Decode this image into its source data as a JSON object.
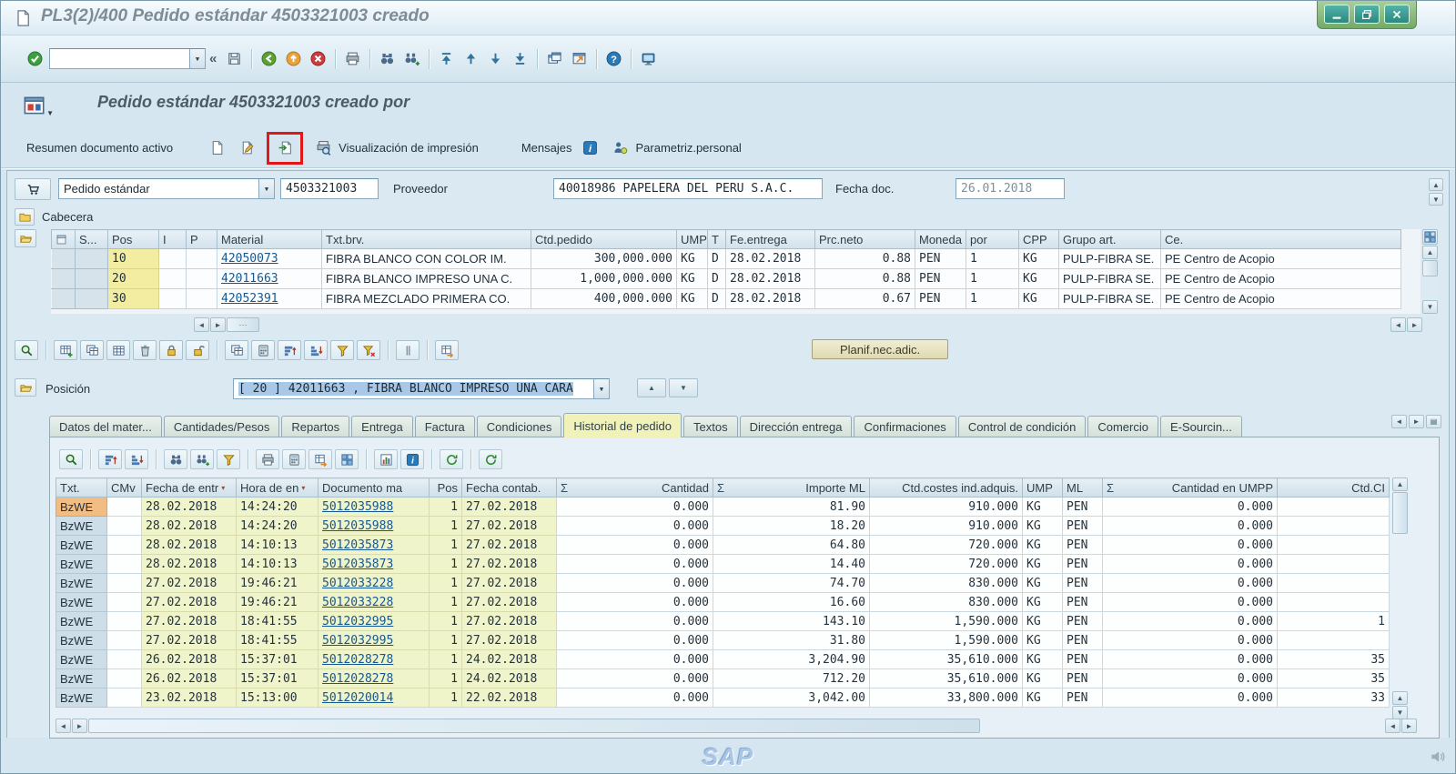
{
  "window": {
    "title": "PL3(2)/400 Pedido estándar 4503321003 creado"
  },
  "toolbar": {
    "command_value": "",
    "collapse_glyph": "«",
    "icons": [
      "save",
      "sep",
      "back",
      "exit",
      "cancel",
      "sep",
      "print",
      "sep",
      "find",
      "find-next",
      "sep",
      "first-page",
      "prev-page",
      "next-page",
      "last-page",
      "sep",
      "new-session",
      "create-shortcut",
      "sep",
      "help",
      "sep",
      "customize-layout"
    ]
  },
  "app_header": {
    "title": "Pedido estándar 4503321003 creado por"
  },
  "app_toolbar": {
    "overview_label": "Resumen documento activo",
    "icons_left": [
      "create-document",
      "display-change"
    ],
    "highlighted_icon": "other-purchase-document",
    "print_preview_label": "Visualización de impresión",
    "messages_label": "Mensajes",
    "personal_label": "Parametriz.personal"
  },
  "order_header": {
    "type_value": "Pedido estándar",
    "number_value": "4503321003",
    "vendor_label": "Proveedor",
    "vendor_value": "40018986 PAPELERA DEL PERU S.A.C.",
    "date_label": "Fecha doc.",
    "date_value": "26.01.2018"
  },
  "header_section_label": "Cabecera",
  "items": {
    "columns": [
      "",
      "S...",
      "Pos",
      "I",
      "P",
      "Material",
      "Txt.brv.",
      "Ctd.pedido",
      "UMP",
      "T",
      "Fe.entrega",
      "Prc.neto",
      "Moneda",
      "por",
      "CPP",
      "Grupo art.",
      "Ce."
    ],
    "rows": [
      {
        "pos": "10",
        "i": "",
        "p": "",
        "material": "42050073",
        "txt_brv": "FIBRA BLANCO CON COLOR IM.",
        "ctd_pedido": "300,000.000",
        "ump": "KG",
        "t": "D",
        "fe_entrega": "28.02.2018",
        "prc_neto": "0.88",
        "moneda": "PEN",
        "por": "1",
        "cpp": "KG",
        "grupo_art": "PULP-FIBRA SE.",
        "ce": "PE Centro de Acopio"
      },
      {
        "pos": "20",
        "i": "",
        "p": "",
        "material": "42011663",
        "txt_brv": "FIBRA BLANCO IMPRESO UNA C.",
        "ctd_pedido": "1,000,000.000",
        "ump": "KG",
        "t": "D",
        "fe_entrega": "28.02.2018",
        "prc_neto": "0.88",
        "moneda": "PEN",
        "por": "1",
        "cpp": "KG",
        "grupo_art": "PULP-FIBRA SE.",
        "ce": "PE Centro de Acopio"
      },
      {
        "pos": "30",
        "i": "",
        "p": "",
        "material": "42052391",
        "txt_brv": "FIBRA MEZCLADO PRIMERA CO.",
        "ctd_pedido": "400,000.000",
        "ump": "KG",
        "t": "D",
        "fe_entrega": "28.02.2018",
        "prc_neto": "0.67",
        "moneda": "PEN",
        "por": "1",
        "cpp": "KG",
        "grupo_art": "PULP-FIBRA SE.",
        "ce": "PE Centro de Acopio"
      }
    ],
    "toolbar_icons": [
      "magnifier",
      "sep",
      "table-insert",
      "table-copy",
      "table",
      "trash",
      "lock",
      "unlock",
      "sep",
      "duplicate",
      "calc",
      "sortasc",
      "sortdesc",
      "filter",
      "filter-del",
      "sep",
      "grip",
      "sep",
      "adopt"
    ],
    "planif_button_label": "Planif.nec.adic."
  },
  "position": {
    "label": "Posición",
    "value": "[ 20 ] 42011663 , FIBRA BLANCO IMPRESO UNA CARA"
  },
  "tabs": [
    "Datos del mater...",
    "Cantidades/Pesos",
    "Repartos",
    "Entrega",
    "Factura",
    "Condiciones",
    "Historial de pedido",
    "Textos",
    "Dirección entrega",
    "Confirmaciones",
    "Control de condición",
    "Comercio",
    "E-Sourcin..."
  ],
  "active_tab": "Historial de pedido",
  "history": {
    "sigma_symbol": "Σ",
    "toolbar_icons": [
      "details",
      "sep",
      "sortasc",
      "sortdesc",
      "sep",
      "find",
      "find-next",
      "filter",
      "sep",
      "print",
      "export-calc",
      "export-file",
      "views",
      "sep",
      "chart",
      "info",
      "sep",
      "refresh-menu",
      "sep",
      "refresh"
    ],
    "columns": [
      {
        "label": "Txt."
      },
      {
        "label": "CMv"
      },
      {
        "label": "Fecha de entr",
        "sort": true
      },
      {
        "label": "Hora de en",
        "sort": true
      },
      {
        "label": "Documento ma"
      },
      {
        "label": "Pos"
      },
      {
        "label": "Fecha contab."
      },
      {
        "label": "Cantidad",
        "sigma": true
      },
      {
        "label": "Importe ML",
        "sigma": true
      },
      {
        "label": "Ctd.costes ind.adquis."
      },
      {
        "label": "UMP"
      },
      {
        "label": "ML"
      },
      {
        "label": "Cantidad en UMPP",
        "sigma": true
      },
      {
        "label": "Ctd.CI"
      }
    ],
    "rows": [
      [
        "BzWE",
        "",
        "28.02.2018",
        "14:24:20",
        "5012035988",
        "1",
        "27.02.2018",
        "0.000",
        "81.90",
        "910.000",
        "KG",
        "PEN",
        "0.000",
        ""
      ],
      [
        "BzWE",
        "",
        "28.02.2018",
        "14:24:20",
        "5012035988",
        "1",
        "27.02.2018",
        "0.000",
        "18.20",
        "910.000",
        "KG",
        "PEN",
        "0.000",
        ""
      ],
      [
        "BzWE",
        "",
        "28.02.2018",
        "14:10:13",
        "5012035873",
        "1",
        "27.02.2018",
        "0.000",
        "64.80",
        "720.000",
        "KG",
        "PEN",
        "0.000",
        ""
      ],
      [
        "BzWE",
        "",
        "28.02.2018",
        "14:10:13",
        "5012035873",
        "1",
        "27.02.2018",
        "0.000",
        "14.40",
        "720.000",
        "KG",
        "PEN",
        "0.000",
        ""
      ],
      [
        "BzWE",
        "",
        "27.02.2018",
        "19:46:21",
        "5012033228",
        "1",
        "27.02.2018",
        "0.000",
        "74.70",
        "830.000",
        "KG",
        "PEN",
        "0.000",
        ""
      ],
      [
        "BzWE",
        "",
        "27.02.2018",
        "19:46:21",
        "5012033228",
        "1",
        "27.02.2018",
        "0.000",
        "16.60",
        "830.000",
        "KG",
        "PEN",
        "0.000",
        ""
      ],
      [
        "BzWE",
        "",
        "27.02.2018",
        "18:41:55",
        "5012032995",
        "1",
        "27.02.2018",
        "0.000",
        "143.10",
        "1,590.000",
        "KG",
        "PEN",
        "0.000",
        "1"
      ],
      [
        "BzWE",
        "",
        "27.02.2018",
        "18:41:55",
        "5012032995",
        "1",
        "27.02.2018",
        "0.000",
        "31.80",
        "1,590.000",
        "KG",
        "PEN",
        "0.000",
        ""
      ],
      [
        "BzWE",
        "",
        "26.02.2018",
        "15:37:01",
        "5012028278",
        "1",
        "24.02.2018",
        "0.000",
        "3,204.90",
        "35,610.000",
        "KG",
        "PEN",
        "0.000",
        "35"
      ],
      [
        "BzWE",
        "",
        "26.02.2018",
        "15:37:01",
        "5012028278",
        "1",
        "24.02.2018",
        "0.000",
        "712.20",
        "35,610.000",
        "KG",
        "PEN",
        "0.000",
        "35"
      ],
      [
        "BzWE",
        "",
        "23.02.2018",
        "15:13:00",
        "5012020014",
        "1",
        "22.02.2018",
        "0.000",
        "3,042.00",
        "33,800.000",
        "KG",
        "PEN",
        "0.000",
        "33"
      ]
    ]
  },
  "footer": {
    "logo": "SAP"
  },
  "colors": {
    "annotation_red": "#e01818",
    "link": "#17578f",
    "active_tab_bg": "#f0f2ba",
    "lead_cell_orange": "#f1bd83",
    "key_cell_blue": "#cddee9",
    "date_cell_yellow": "#f0f4ca",
    "pos_cell_yellow": "#f3eda2"
  }
}
